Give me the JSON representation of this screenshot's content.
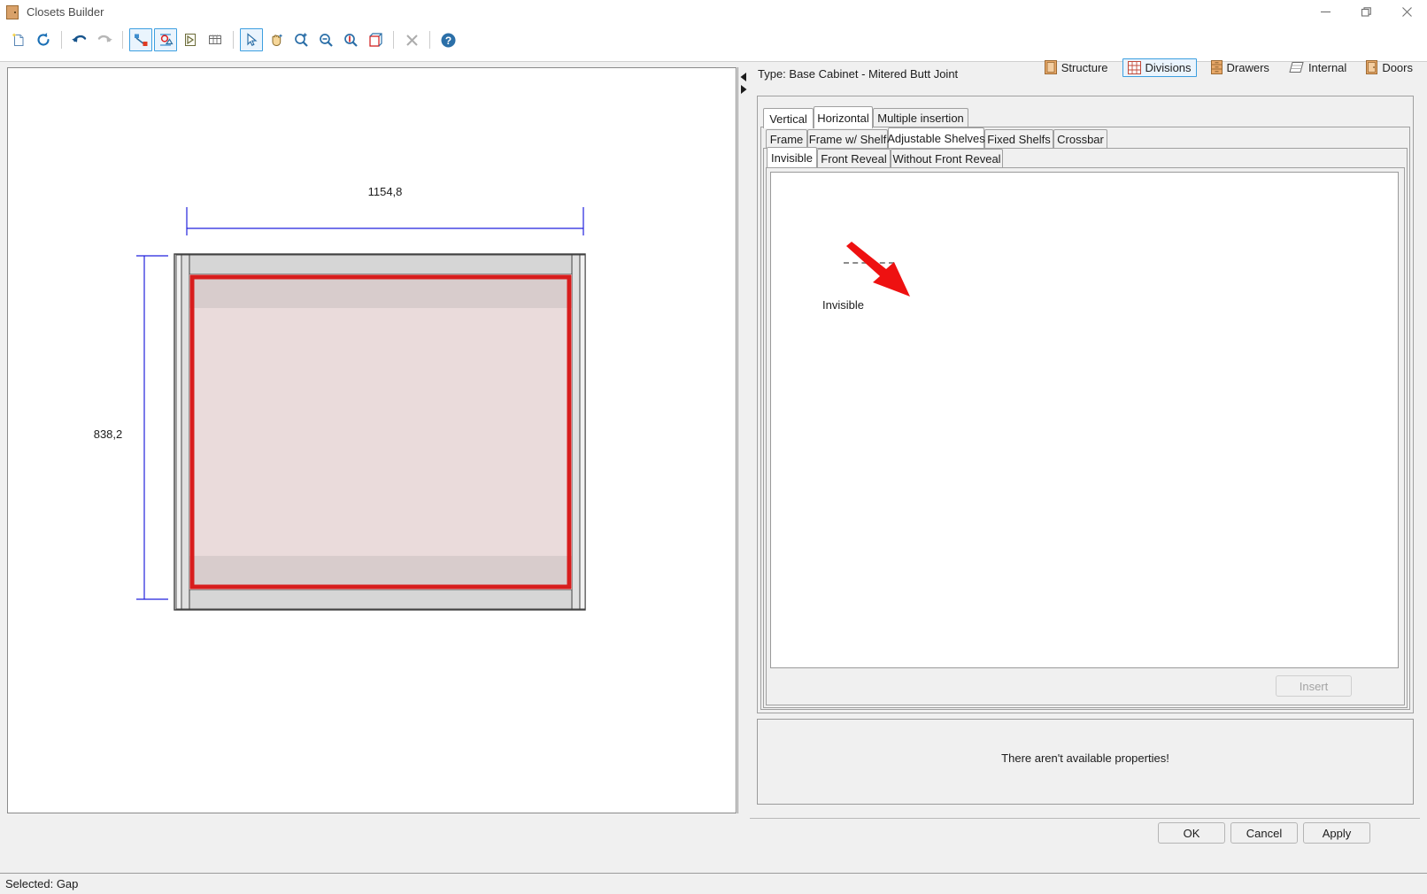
{
  "window": {
    "title": "Closets Builder",
    "icon": "cabinet-icon",
    "controls": {
      "minimize": "minimize-icon",
      "maximize": "restore-icon",
      "close": "close-icon"
    }
  },
  "toolbar": {
    "buttons": [
      {
        "name": "new-file-icon",
        "label": "New",
        "selected": false
      },
      {
        "name": "reload-icon",
        "label": "Reload",
        "selected": false
      },
      {
        "name": "undo-icon",
        "label": "Undo",
        "selected": false
      },
      {
        "name": "redo-icon",
        "label": "Redo",
        "selected": false
      },
      {
        "name": "select-element-icon",
        "label": "Select Element",
        "selected": true
      },
      {
        "name": "edit-shape-icon",
        "label": "Edit Shape",
        "selected": true
      },
      {
        "name": "play-icon",
        "label": "Run",
        "selected": false
      },
      {
        "name": "grid-icon",
        "label": "Grid",
        "selected": false
      },
      {
        "name": "pointer-icon",
        "label": "Pointer",
        "selected": true
      },
      {
        "name": "pan-hand-icon",
        "label": "Pan",
        "selected": false
      },
      {
        "name": "zoom-window-icon",
        "label": "Zoom Window",
        "selected": false
      },
      {
        "name": "zoom-out-icon",
        "label": "Zoom Out",
        "selected": false
      },
      {
        "name": "zoom-in-icon",
        "label": "Zoom In",
        "selected": false
      },
      {
        "name": "view-3d-icon",
        "label": "3D View",
        "selected": false
      },
      {
        "name": "delete-icon",
        "label": "Delete",
        "selected": false
      },
      {
        "name": "help-icon",
        "label": "Help",
        "selected": false
      }
    ]
  },
  "ribbon": {
    "items": [
      {
        "label": "Structure",
        "icon": "structure-icon",
        "selected": false
      },
      {
        "label": "Divisions",
        "icon": "divisions-grid-icon",
        "selected": true
      },
      {
        "label": "Drawers",
        "icon": "drawers-icon",
        "selected": false
      },
      {
        "label": "Internal",
        "icon": "internal-icon",
        "selected": false
      },
      {
        "label": "Doors",
        "icon": "doors-icon",
        "selected": false
      }
    ]
  },
  "canvas": {
    "dimensions": {
      "width_label": "1154,8",
      "height_label": "838,2"
    },
    "colors": {
      "dimension_line": "#2222dd",
      "selection": "#d81d1d",
      "panel_fill": "#d6d6d6",
      "interior_fill": "#eadbdb",
      "outline": "#404040"
    }
  },
  "panel": {
    "type_line": "Type: Base Cabinet - Mitered Butt Joint",
    "splitter": {
      "collapse_icon": "arrow-left-icon",
      "expand_icon": "arrow-right-icon"
    },
    "tabs_level1": [
      {
        "label": "Vertical",
        "active": false
      },
      {
        "label": "Horizontal",
        "active": true
      },
      {
        "label": "Multiple insertion",
        "active": false
      }
    ],
    "tabs_level2": [
      {
        "label": "Frame",
        "active": false
      },
      {
        "label": "Frame w/ Shelf",
        "active": false
      },
      {
        "label": "Adjustable Shelves",
        "active": true
      },
      {
        "label": "Fixed Shelfs",
        "active": false
      },
      {
        "label": "Crossbar",
        "active": false
      }
    ],
    "tabs_level3": [
      {
        "label": "Invisible",
        "active": true
      },
      {
        "label": "Front Reveal",
        "active": false
      },
      {
        "label": "Without Front Reveal",
        "active": false
      }
    ],
    "gallery": {
      "items": [
        {
          "label": "Invisible",
          "icon": "dashed-shelf-icon"
        }
      ]
    },
    "insert_button": {
      "label": "Insert",
      "enabled": false
    },
    "properties_message": "There aren't available properties!"
  },
  "dialog_buttons": [
    {
      "label": "OK",
      "name": "ok-button"
    },
    {
      "label": "Cancel",
      "name": "cancel-button"
    },
    {
      "label": "Apply",
      "name": "apply-button"
    }
  ],
  "statusbar": {
    "text": "Selected: Gap"
  },
  "annotation": {
    "type": "red-arrow-pointer",
    "color": "#ee1111"
  }
}
